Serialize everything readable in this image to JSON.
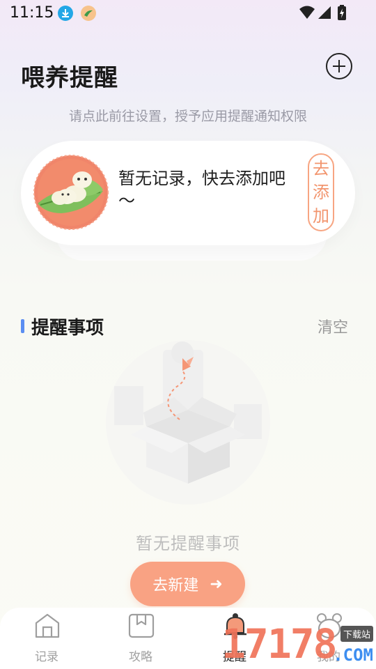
{
  "status_bar": {
    "time": "11:15"
  },
  "header": {
    "title": "喂养提醒",
    "add_icon": "plus-circle-icon"
  },
  "permission_hint": "请点此前往设置，授予应用提醒通知权限",
  "record_card": {
    "empty_text": "暂无记录，快去添加吧～",
    "add_button_label": "去添加",
    "avatar_icon": "silkworm-on-leaf-icon"
  },
  "reminders_section": {
    "title": "提醒事项",
    "clear_label": "清空",
    "empty_text": "暂无提醒事项",
    "new_button_label": "去新建",
    "new_button_arrow": "➜"
  },
  "tabs": [
    {
      "label": "记录",
      "icon": "home-icon",
      "active": false
    },
    {
      "label": "攻略",
      "icon": "bookmark-icon",
      "active": false
    },
    {
      "label": "提醒",
      "icon": "bell-icon",
      "active": true
    },
    {
      "label": "我的",
      "icon": "bear-icon",
      "active": false
    }
  ],
  "watermark": {
    "main": "17178",
    "sub": "下载站",
    "domain": ".COM"
  },
  "colors": {
    "accent": "#f9a283",
    "accent_text": "#f2956e",
    "section_bar": "#5b8ef2"
  }
}
